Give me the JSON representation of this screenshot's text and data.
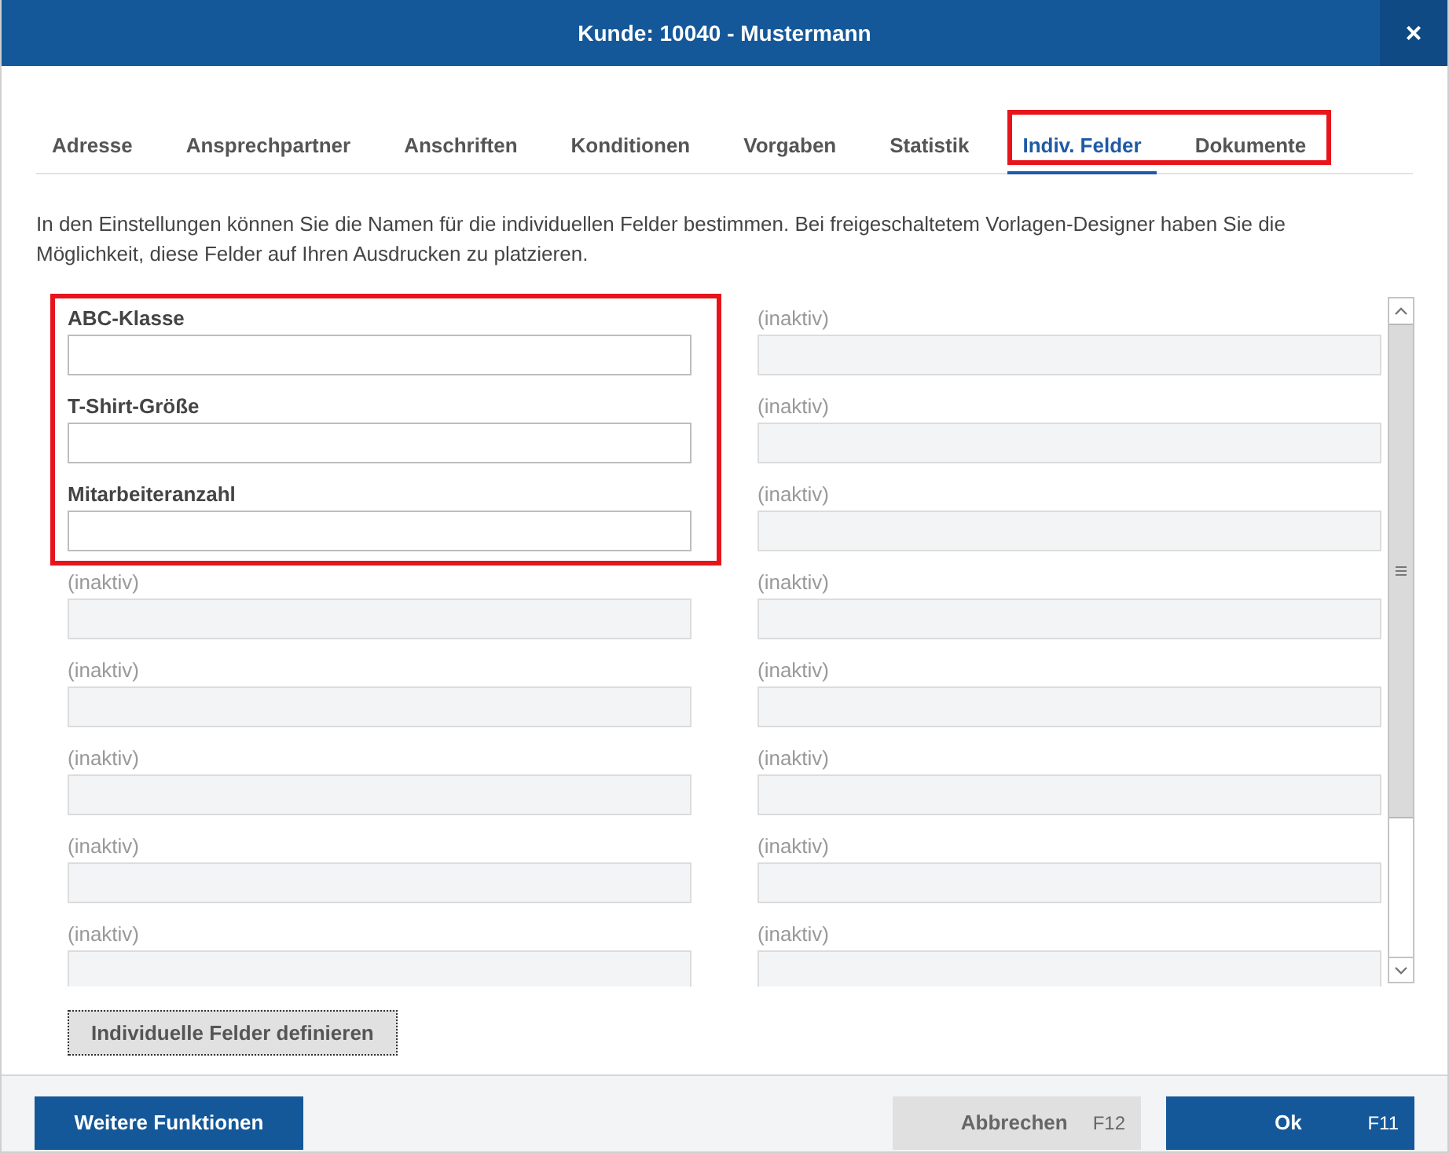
{
  "window": {
    "title": "Kunde: 10040 - Mustermann",
    "close": "×"
  },
  "tabs": [
    {
      "label": "Adresse",
      "selected": false
    },
    {
      "label": "Ansprechpartner",
      "selected": false
    },
    {
      "label": "Anschriften",
      "selected": false
    },
    {
      "label": "Konditionen",
      "selected": false
    },
    {
      "label": "Vorgaben",
      "selected": false
    },
    {
      "label": "Statistik",
      "selected": false
    },
    {
      "label": "Indiv. Felder",
      "selected": true
    },
    {
      "label": "Dokumente",
      "selected": false
    }
  ],
  "description": "In den Einstellungen können Sie die Namen für die individuellen Felder bestimmen. Bei freigeschaltetem Vorlagen-Designer haben Sie die Möglichkeit, diese Felder auf Ihren Ausdrucken zu platzieren.",
  "fields": {
    "left": [
      {
        "label": "ABC-Klasse",
        "active": true
      },
      {
        "label": "T-Shirt-Größe",
        "active": true
      },
      {
        "label": "Mitarbeiteranzahl",
        "active": true
      },
      {
        "label": "(inaktiv)",
        "active": false
      },
      {
        "label": "(inaktiv)",
        "active": false
      },
      {
        "label": "(inaktiv)",
        "active": false
      },
      {
        "label": "(inaktiv)",
        "active": false
      },
      {
        "label": "(inaktiv)",
        "active": false
      }
    ],
    "right": [
      {
        "label": "(inaktiv)",
        "active": false
      },
      {
        "label": "(inaktiv)",
        "active": false
      },
      {
        "label": "(inaktiv)",
        "active": false
      },
      {
        "label": "(inaktiv)",
        "active": false
      },
      {
        "label": "(inaktiv)",
        "active": false
      },
      {
        "label": "(inaktiv)",
        "active": false
      },
      {
        "label": "(inaktiv)",
        "active": false
      },
      {
        "label": "(inaktiv)",
        "active": false
      }
    ]
  },
  "define_button": "Individuelle Felder definieren",
  "footer": {
    "more_button": "Weitere Funktionen",
    "cancel_button": {
      "label": "Abbrechen",
      "shortcut": "F12"
    },
    "ok_button": {
      "label": "Ok",
      "shortcut": "F11"
    }
  }
}
